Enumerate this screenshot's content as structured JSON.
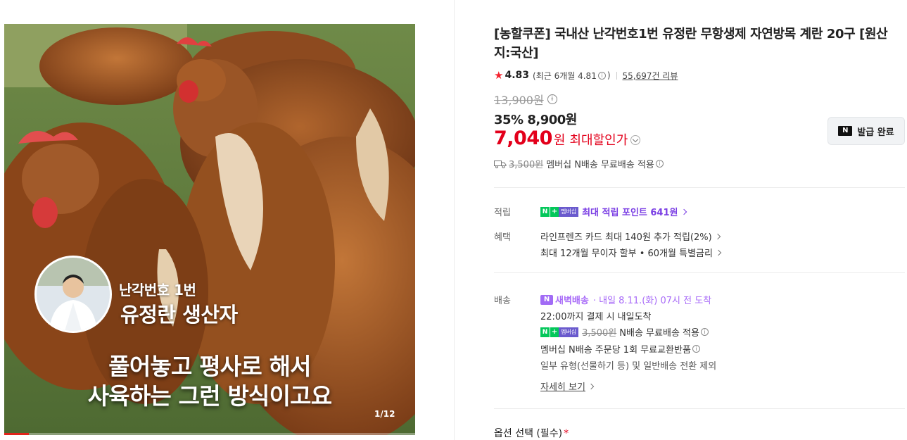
{
  "media": {
    "producer_line1": "난각번호 1번",
    "producer_line2": "유정란 생산자",
    "caption_line1": "풀어놓고 평사로 해서",
    "caption_line2": "사육하는 그런 방식이고요",
    "counter": "1/12",
    "progress": 0.06
  },
  "product": {
    "title": "[농할쿠폰] 국내산 난각번호1번 유정란 무항생제 자연방목 계란 20구 [원산지:국산]",
    "rating": {
      "star_icon": "star-icon",
      "score": "4.83",
      "recent_text": "(최근 6개월 4.81",
      "recent_close": ")",
      "reviews": "55,697건 리뷰"
    },
    "original_price": "13,900원",
    "discount_line": "35% 8,900원",
    "max_price": "7,040",
    "max_unit": "원",
    "max_label": "최대할인가",
    "coupon_button": "발급 완료",
    "coupon_icon_text": "N",
    "shipping_original": "3,500원",
    "shipping_text": "멤버십 N배송 무료배송 적용"
  },
  "benefits": {
    "points_label": "적립",
    "points_text": "최대 적립 포인트 641원",
    "perks_label": "혜택",
    "perk1": "라인프렌즈 카드 최대 140원 추가 적립(2%)",
    "perk2": "최대 12개월 무이자 할부 • 60개월 특별금리"
  },
  "delivery": {
    "label": "배송",
    "dawn_badge": "N",
    "dawn_label": "새벽배송",
    "dawn_date": "· 내일 8.11.(화) 07시 전 도착",
    "order_by": "22:00까지 결제 시 내일도착",
    "free_original": "3,500원",
    "free_text": "N배송 무료배송 적용",
    "exchange": "멤버십 N배송 주문당 1회 무료교환반품",
    "exclusion": "일부 유형(선물하기 등) 및 일반배송 전환 제외",
    "details_link": "자세히 보기"
  },
  "nplus_badge": {
    "n": "N",
    "plus": "+",
    "text": "멤버십"
  },
  "options": {
    "label": "옵션 선택 (필수)",
    "required_mark": "*"
  },
  "colors": {
    "accent_red": "#e3001b",
    "membership_purple": "#7b3fe4",
    "naver_green": "#03c75a"
  }
}
